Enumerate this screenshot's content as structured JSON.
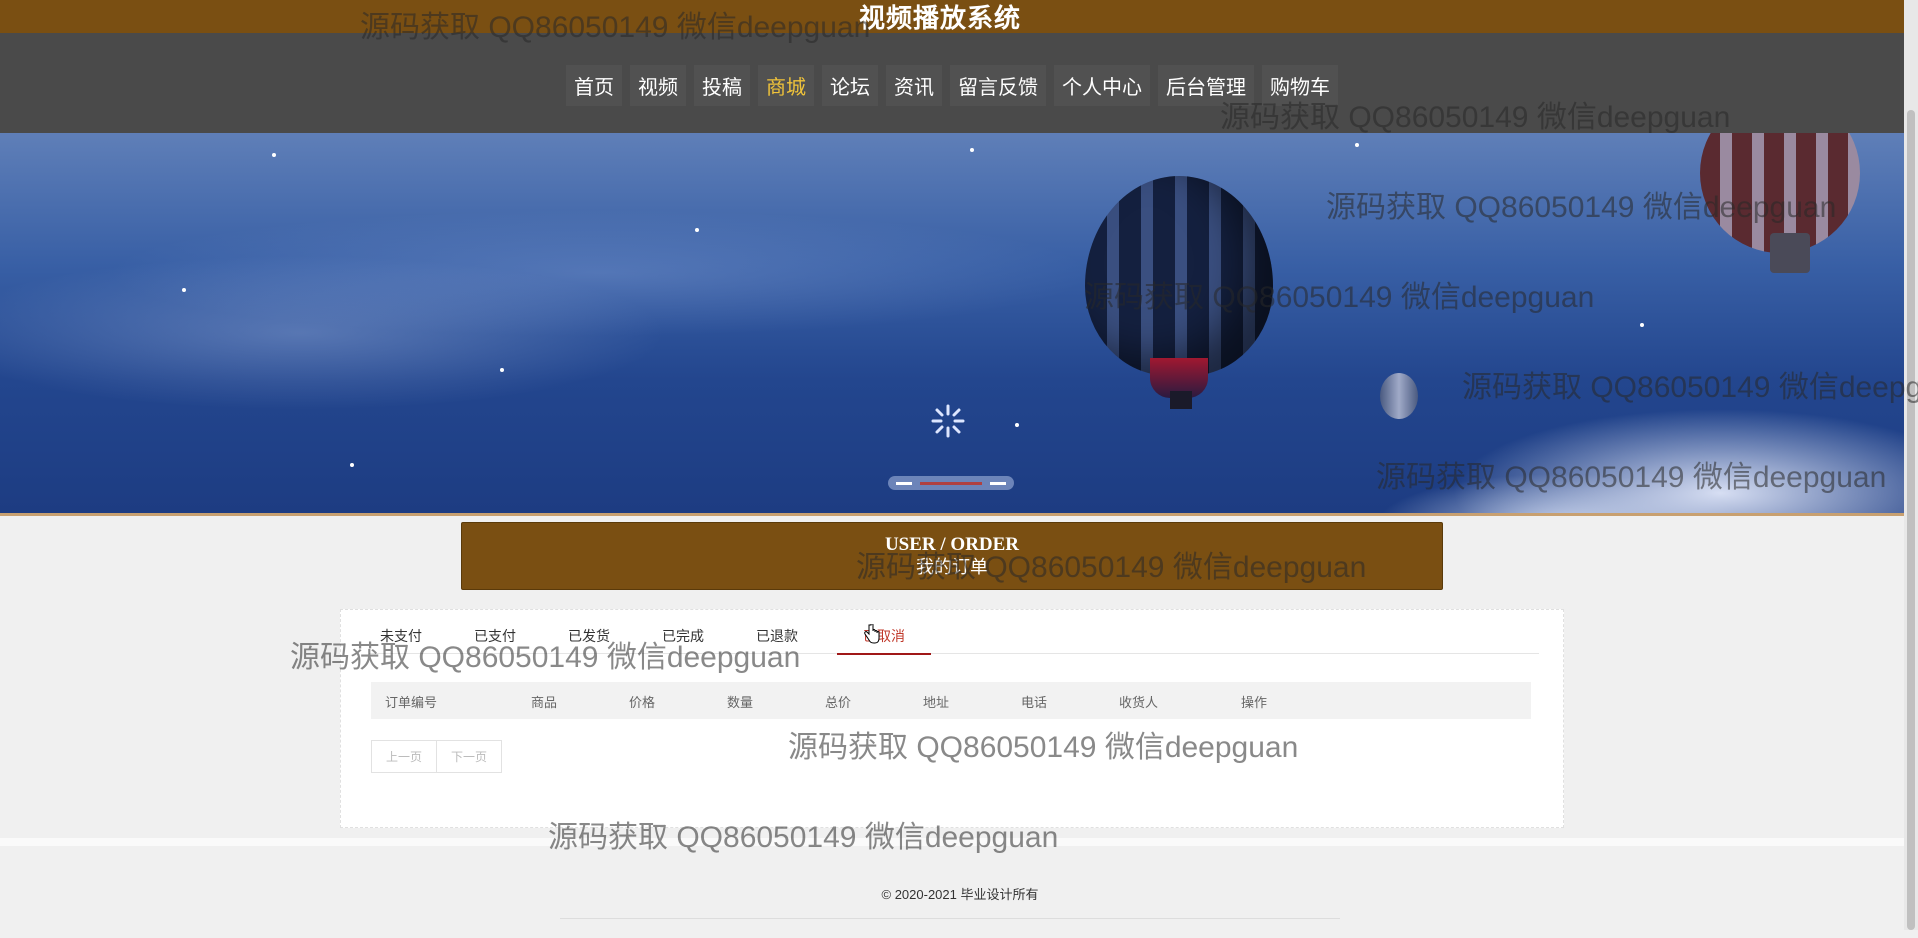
{
  "header": {
    "site_title": "视频播放系统",
    "nav": [
      "首页",
      "视频",
      "投稿",
      "商城",
      "论坛",
      "资讯",
      "留言反馈",
      "个人中心",
      "后台管理",
      "购物车"
    ],
    "active_nav": "商城"
  },
  "banner": {
    "loading_icon": "spinner-icon",
    "slider_indicator": "carousel-dots"
  },
  "section": {
    "title_en": "USER / ORDER",
    "title_zh": "我的订单"
  },
  "order_tabs": {
    "items": [
      "未支付",
      "已支付",
      "已发货",
      "已完成",
      "已退款",
      "已取消"
    ],
    "active": "已取消"
  },
  "table": {
    "columns": [
      "订单编号",
      "商品",
      "价格",
      "数量",
      "总价",
      "地址",
      "电话",
      "收货人",
      "操作"
    ]
  },
  "pager": {
    "prev": "上一页",
    "next": "下一页"
  },
  "footer": {
    "copyright": "© 2020-2021 毕业设计所有"
  },
  "watermark": {
    "text": "源码获取 QQ86050149 微信deepguan"
  },
  "colors": {
    "brand_brown": "#7a4f12",
    "nav_bg": "#4a4a4a",
    "nav_active": "#f0c33a",
    "tab_active": "#c0392b"
  }
}
